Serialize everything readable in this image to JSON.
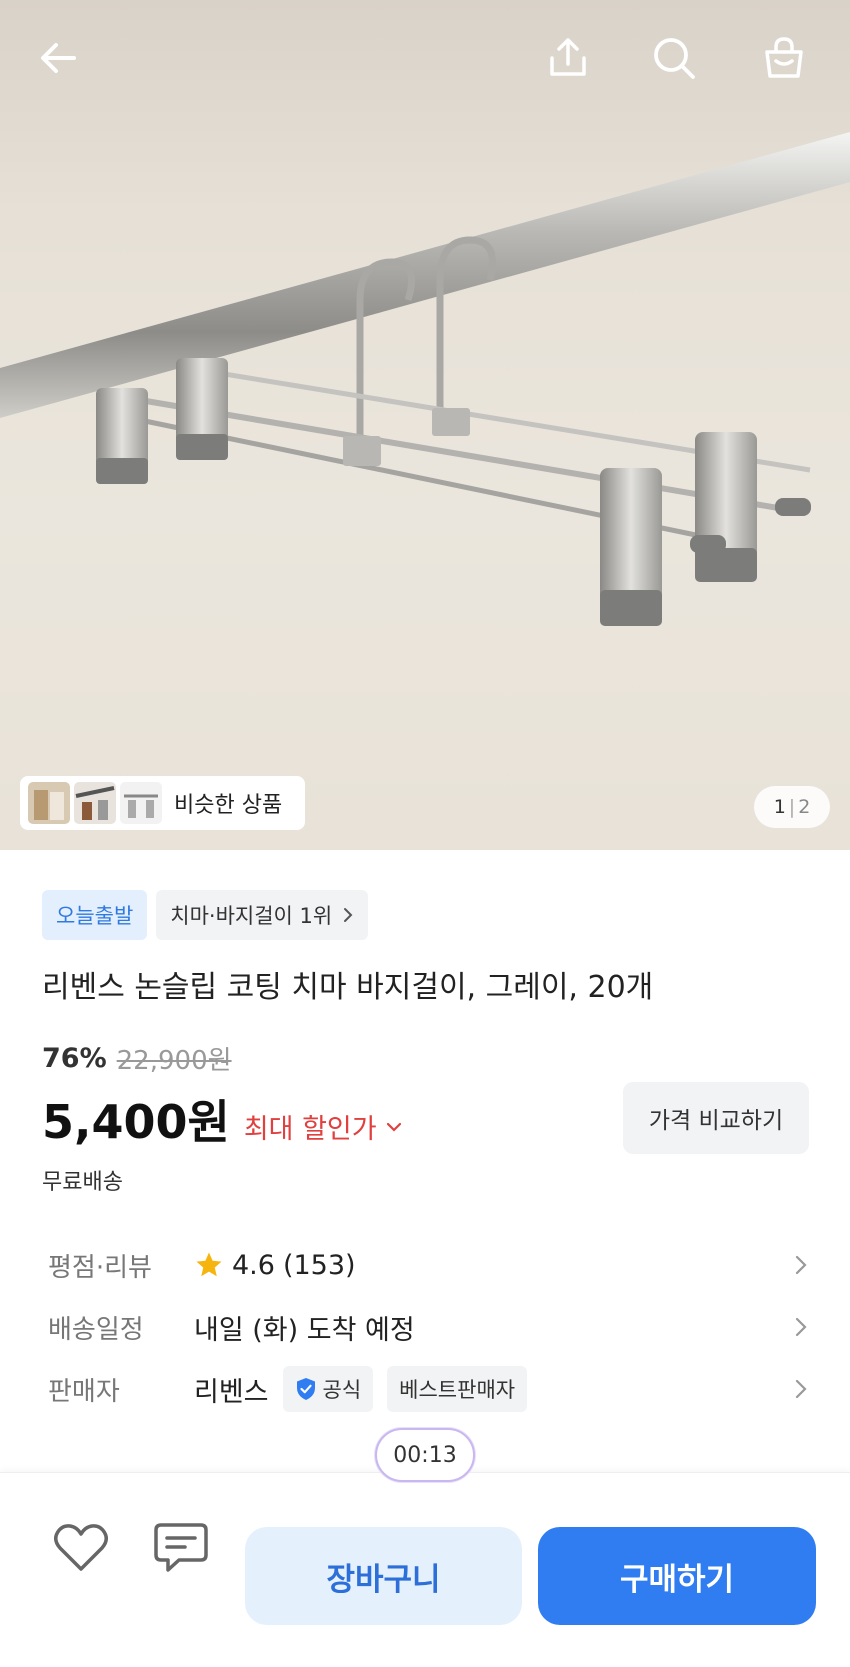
{
  "hero": {
    "page_current": "1",
    "page_separator": "|",
    "page_total": "2",
    "similar_label": "비슷한 상품"
  },
  "header": {
    "back_icon": "arrow-left-icon",
    "share_icon": "share-icon",
    "search_icon": "search-icon",
    "cart_icon": "shopping-bag-icon"
  },
  "badges": {
    "today_label": "오늘출발",
    "rank_label": "치마·바지걸이 1위"
  },
  "product": {
    "title": "리벤스 논슬립 코팅 치마 바지걸이, 그레이, 20개",
    "discount_rate": "76%",
    "original_price": "22,900원",
    "price": "5,400원",
    "max_discount_label": "최대 할인가",
    "compare_label": "가격 비교하기",
    "shipping_free": "무료배송"
  },
  "info": {
    "rating_key": "평점·리뷰",
    "rating_value": "4.6",
    "review_count": "(153)",
    "delivery_key": "배송일정",
    "delivery_value": "내일 (화) 도착 예정",
    "seller_key": "판매자",
    "seller_name": "리벤스",
    "official_label": "공식",
    "best_seller_label": "베스트판매자"
  },
  "timer": "00:13",
  "bottom": {
    "cart_label": "장바구니",
    "buy_label": "구매하기"
  },
  "colors": {
    "accent": "#2f7df0",
    "accent_light": "#e5f0fd",
    "discount_red": "#e0403f",
    "star": "#f6b40e"
  }
}
